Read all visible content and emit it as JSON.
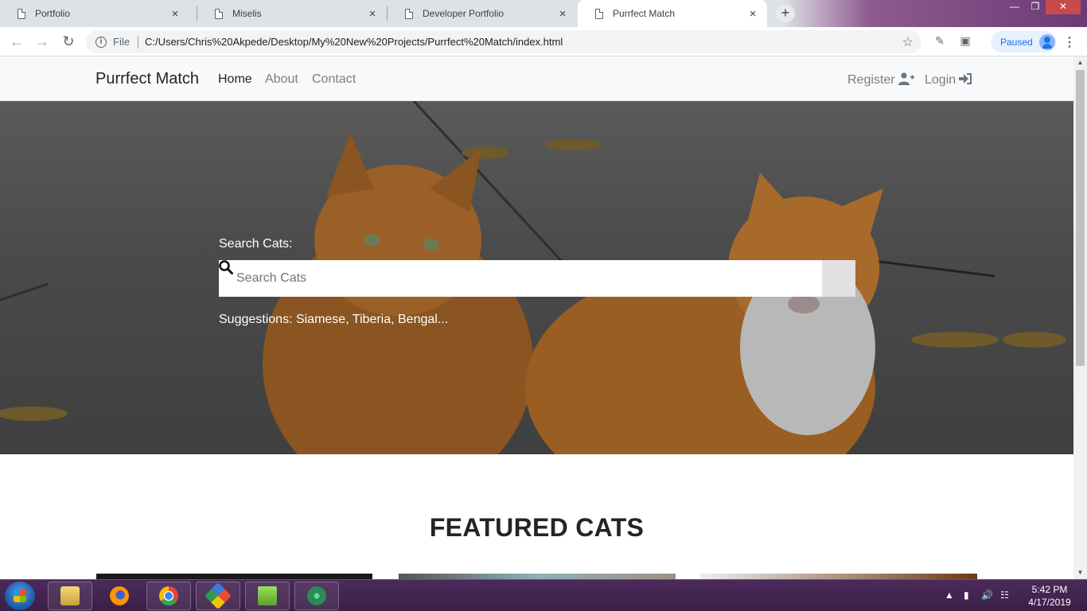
{
  "browser": {
    "tabs": [
      {
        "title": "Portfolio",
        "active": false
      },
      {
        "title": "Miselis",
        "active": false
      },
      {
        "title": "Developer Portfolio",
        "active": false
      },
      {
        "title": "Purrfect Match",
        "active": true
      }
    ],
    "new_tab_icon": "+",
    "close_glyph": "×",
    "address": {
      "scheme": "File",
      "url": "C:/Users/Chris%20Akpede/Desktop/My%20New%20Projects/Purrfect%20Match/index.html"
    },
    "profile_status": "Paused"
  },
  "site": {
    "brand": "Purrfect Match",
    "nav": {
      "home": "Home",
      "about": "About",
      "contact": "Contact"
    },
    "auth": {
      "register": "Register",
      "login": "Login"
    },
    "hero": {
      "search_label": "Search Cats:",
      "search_placeholder": "Search Cats",
      "suggestions": "Suggestions: Siamese, Tiberia, Bengal..."
    },
    "featured_title": "FEATURED CATS"
  },
  "taskbar": {
    "apps": [
      "file-explorer",
      "firefox",
      "chrome",
      "git",
      "notepad-plus-plus",
      "atom"
    ],
    "time": "5:42 PM",
    "date": "4/17/2019"
  },
  "colors": {
    "navbar_bg": "#f8f9fa",
    "hero_overlay": "#3f3f3f",
    "taskbar": "#3a1f48"
  }
}
